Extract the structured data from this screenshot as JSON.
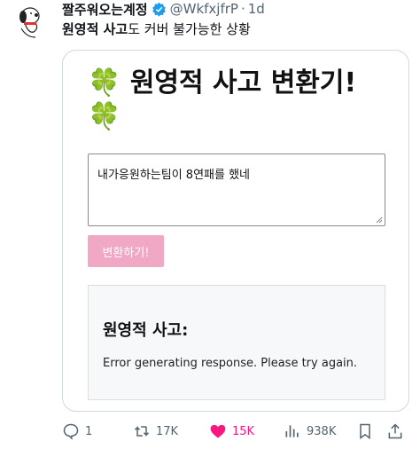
{
  "tweet": {
    "display_name": "짤주워오는계정",
    "handle": "@WkfxjfrP",
    "separator": "·",
    "time": "1d",
    "text_bold": "원영적 사고",
    "text_rest": "도 커버 불가능한 상황"
  },
  "media": {
    "title_text": "원영적 사고 변환기!",
    "clover_1": "🍀",
    "clover_2": "🍀",
    "input_value": "내가응원하는팀이  8연패를  했네",
    "convert_button": "변환하기!",
    "result_title": "원영적 사고:",
    "result_text": "Error generating response. Please try again."
  },
  "actions": {
    "replies": "1",
    "retweets": "17K",
    "likes": "15K",
    "views": "938K"
  },
  "colors": {
    "like_active": "#f91880",
    "verified": "#1d9bf0",
    "button_pink": "#f0a8c4"
  },
  "icons": [
    "avatar-snoopy",
    "verified-badge-icon",
    "reply-icon",
    "retweet-icon",
    "heart-icon",
    "views-icon",
    "bookmark-icon",
    "share-icon"
  ]
}
